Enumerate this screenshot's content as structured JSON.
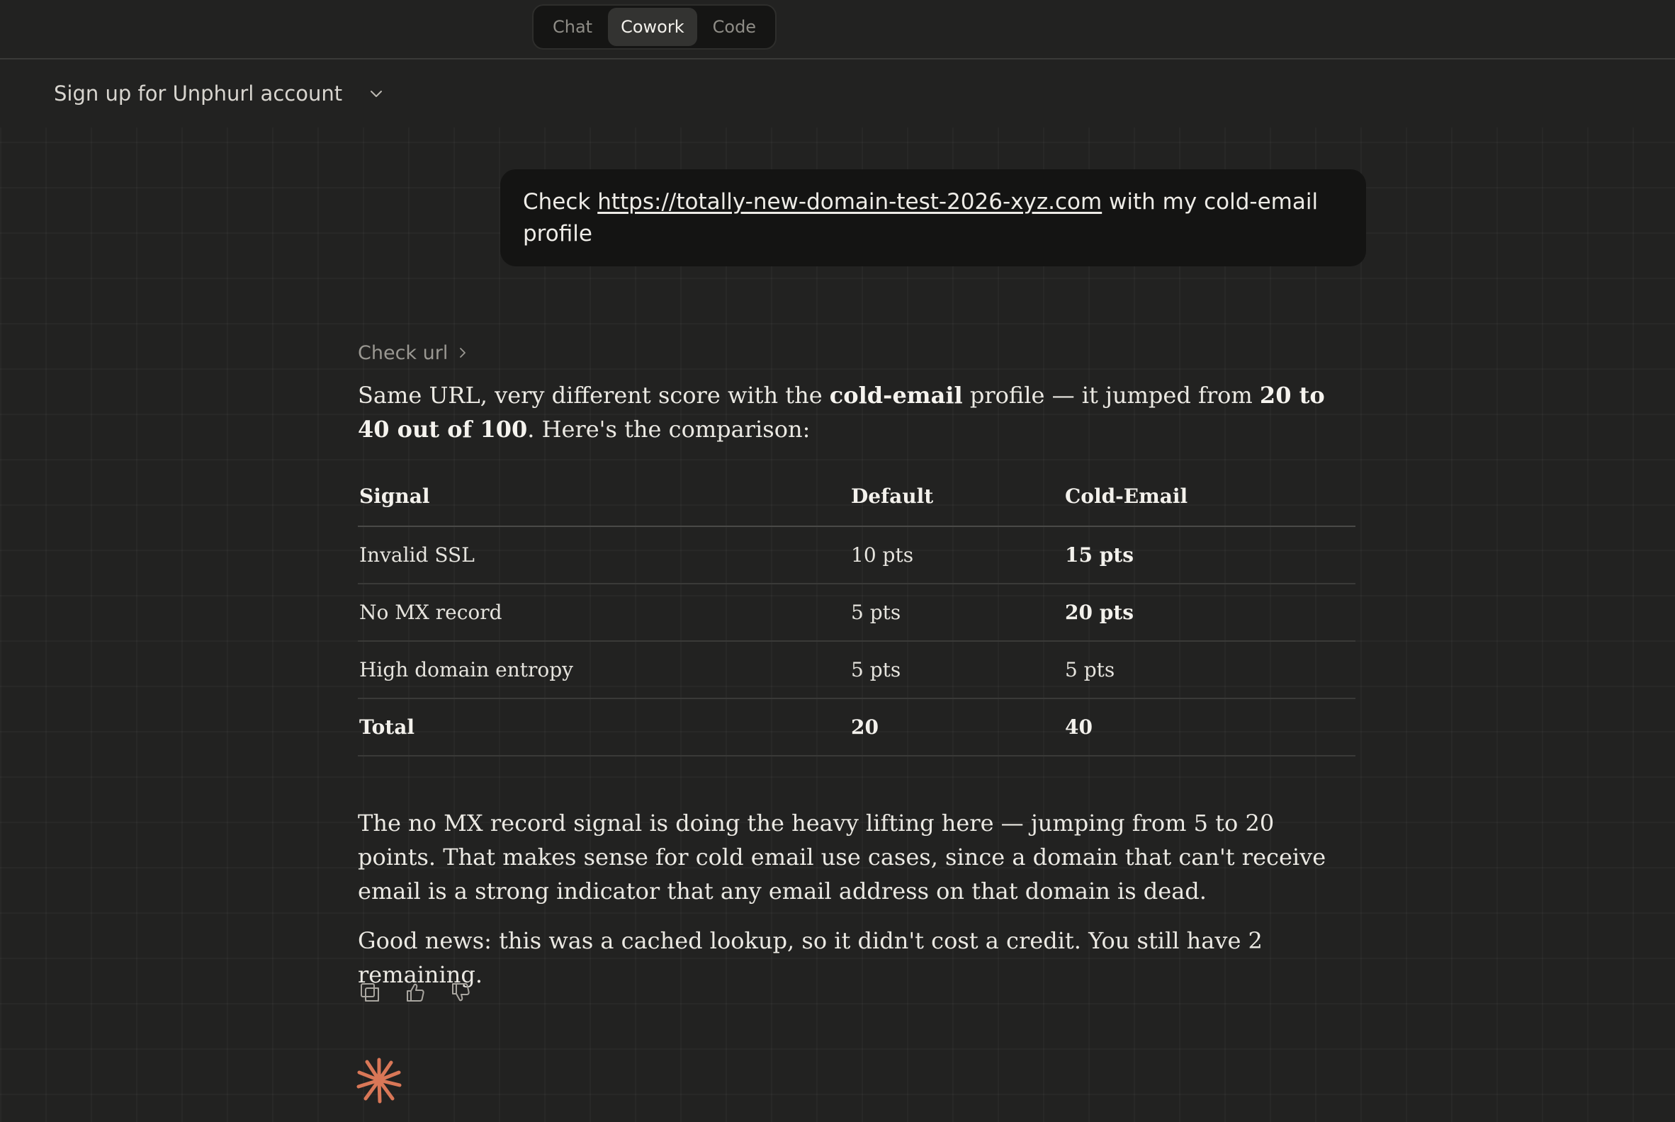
{
  "mode_switch": {
    "tabs": [
      "Chat",
      "Cowork",
      "Code"
    ],
    "active": "Cowork"
  },
  "conversation": {
    "title": "Sign up for Unphurl account"
  },
  "user_message": {
    "prefix": "Check ",
    "link": "https://totally-new-domain-test-2026-xyz.com",
    "suffix": " with my cold-email profile"
  },
  "tool_call": {
    "label": "Check url"
  },
  "response": {
    "intro": {
      "t1": "Same URL, very different score with the ",
      "b1": "cold-email",
      "t2": " profile — it jumped from ",
      "b2": "20 to 40 out of 100",
      "t3": ". Here's the comparison:"
    },
    "table": {
      "headers": [
        "Signal",
        "Default",
        "Cold-Email"
      ],
      "rows": [
        [
          "Invalid SSL",
          "10 pts",
          "15 pts"
        ],
        [
          "No MX record",
          "5 pts",
          "20 pts"
        ],
        [
          "High domain entropy",
          "5 pts",
          "5 pts"
        ]
      ],
      "total": [
        "Total",
        "20",
        "40"
      ]
    },
    "para2": "The no MX record signal is doing the heavy lifting here — jumping from 5 to 20 points. That makes sense for cold email use cases, since a domain that can't receive email is a strong indicator that any email address on that domain is dead.",
    "para3": "Good news: this was a cached lookup, so it didn't cost a credit. You still have 2 remaining."
  },
  "icons": {
    "copy": "copy-icon",
    "thumbs_up": "thumbs-up-icon",
    "thumbs_down": "thumbs-down-icon",
    "spark": "claude-spark-icon"
  },
  "colors": {
    "background": "#222221",
    "bubble": "#141413",
    "accent": "#d97757"
  }
}
